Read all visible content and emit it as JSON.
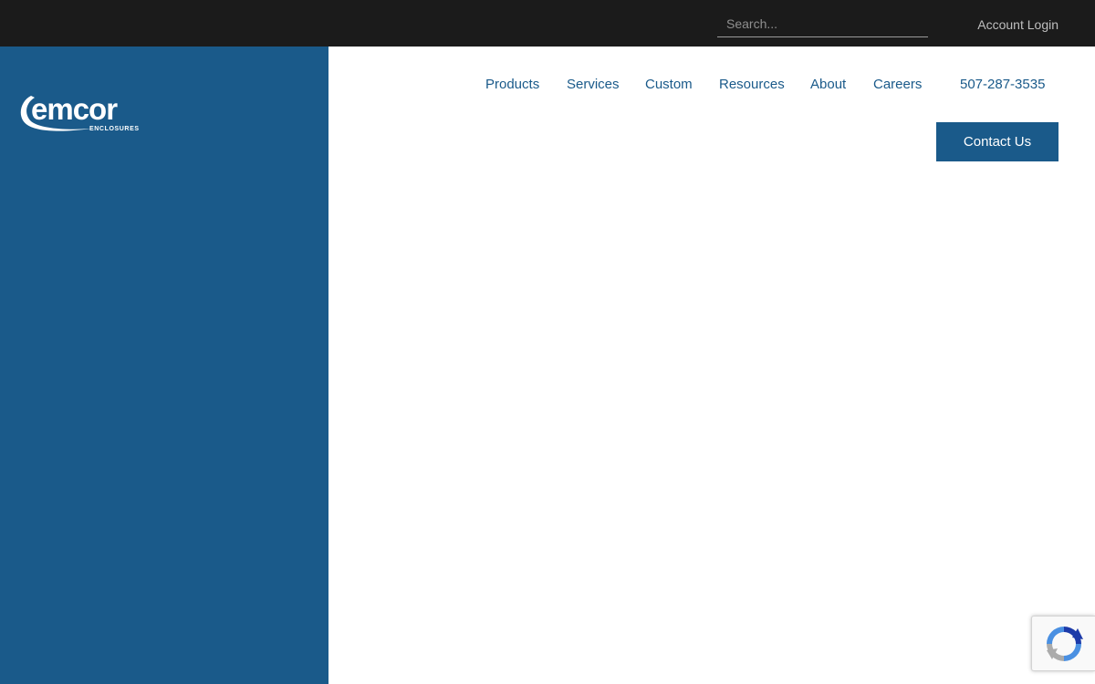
{
  "topbar": {
    "search": {
      "placeholder": "Search...",
      "value": ""
    },
    "account_login": "Account Login"
  },
  "brand": {
    "logo_text": "emcor",
    "logo_subtext": "ENCLOSURES",
    "primary_color": "#1a5a8a"
  },
  "nav": {
    "items": [
      {
        "label": "Products"
      },
      {
        "label": "Services"
      },
      {
        "label": "Custom"
      },
      {
        "label": "Resources"
      },
      {
        "label": "About"
      },
      {
        "label": "Careers"
      }
    ],
    "phone": "507-287-3535",
    "contact_label": "Contact Us"
  },
  "widgets": {
    "recaptcha_icon": "recaptcha-icon"
  }
}
